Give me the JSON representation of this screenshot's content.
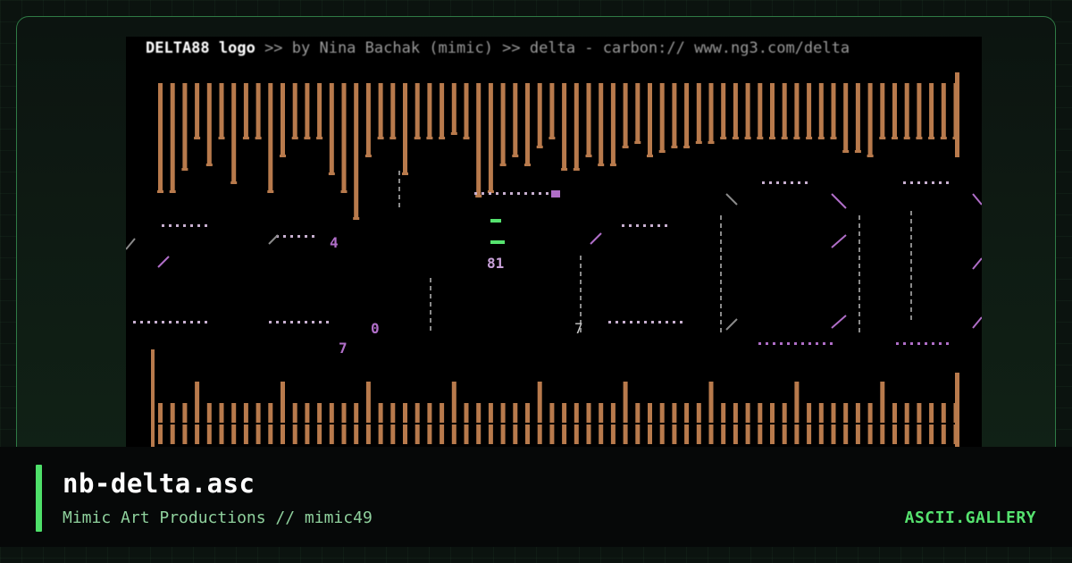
{
  "art": {
    "header_title": "DELTA88 logo",
    "header_rest": " >> by Nina Bachak (mimic) >> delta - carbon:// www.ng3.com/delta",
    "labels": {
      "num_a": "4",
      "num_b": "81",
      "num_c": "0",
      "num_d": "7",
      "num_e": "7"
    }
  },
  "footer": {
    "title": "nb-delta.asc",
    "subtitle": "Mimic Art Productions // mimic49",
    "brand": "ASCII.GALLERY"
  },
  "colors": {
    "accent": "#4ee06a",
    "bars": "#b87a4c",
    "purple": "#b06ec8",
    "lavender": "#c8b0d0",
    "green_text": "#56e36f"
  }
}
